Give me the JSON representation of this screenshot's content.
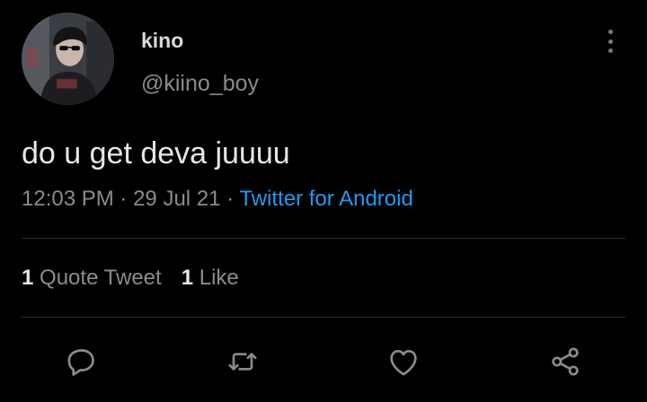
{
  "tweet": {
    "display_name": "kino",
    "handle": "@kiino_boy",
    "text": "do u get deva juuuu",
    "time": "12:03 PM",
    "date": "29 Jul 21",
    "separator": "·",
    "source": "Twitter for Android"
  },
  "stats": {
    "quote_count": "1",
    "quote_label": "Quote Tweet",
    "like_count": "1",
    "like_label": "Like"
  },
  "icons": {
    "more": "more-vertical-icon",
    "reply": "reply-icon",
    "retweet": "retweet-icon",
    "like": "heart-icon",
    "share": "share-icon"
  },
  "colors": {
    "background": "#000000",
    "text_primary": "#e6e6e6",
    "text_secondary": "#8b8b8b",
    "link": "#1d9bf0",
    "divider": "#2c2c2c"
  }
}
